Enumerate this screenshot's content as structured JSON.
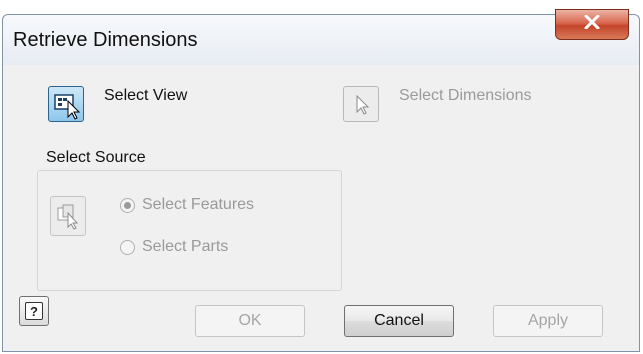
{
  "window": {
    "title": "Retrieve Dimensions",
    "close_icon": "close-x-icon"
  },
  "toolbar": {
    "select_view": {
      "label": "Select View",
      "icon": "select-view-icon",
      "state": "active"
    },
    "select_dimensions": {
      "label": "Select Dimensions",
      "icon": "cursor-arrow-icon",
      "state": "disabled"
    }
  },
  "source_group": {
    "title": "Select Source",
    "icon": "select-source-icon",
    "options": [
      {
        "label": "Select Features",
        "checked": true,
        "enabled": false
      },
      {
        "label": "Select Parts",
        "checked": false,
        "enabled": false
      }
    ]
  },
  "footer": {
    "help_icon": "help-icon",
    "help_glyph": "?",
    "ok_label": "OK",
    "cancel_label": "Cancel",
    "apply_label": "Apply"
  },
  "colors": {
    "close_button": "#c4452a",
    "active_tool": "#8ec7ec",
    "disabled_text": "#9a9a9a",
    "dialog_bg": "#f0f0f0"
  }
}
